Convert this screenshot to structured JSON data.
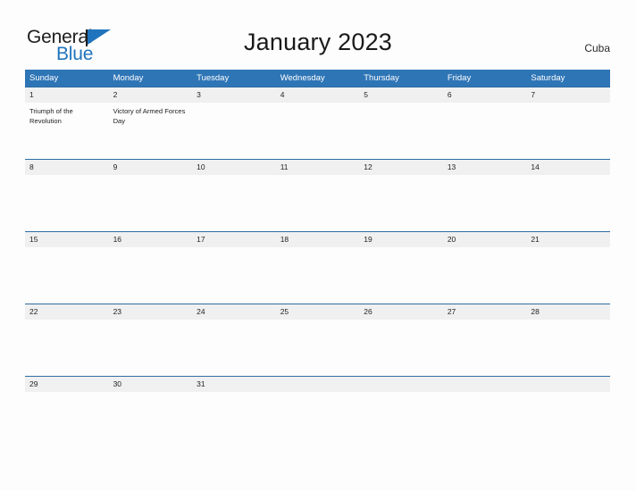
{
  "brand": {
    "name_part1": "General",
    "name_part2": "Blue",
    "flag_icon": "blue-flag-triangle",
    "color_dark": "#1d1d1d",
    "color_blue": "#1f74bd"
  },
  "header": {
    "title": "January 2023",
    "country": "Cuba"
  },
  "theme": {
    "header_blue": "#2e75b6",
    "rule_blue": "#2e6da4",
    "date_strip_gray": "#f0f0f0",
    "page_background": "#fdfdfd"
  },
  "calendar": {
    "month": "January",
    "year": "2023",
    "weekday_headers": [
      "Sunday",
      "Monday",
      "Tuesday",
      "Wednesday",
      "Thursday",
      "Friday",
      "Saturday"
    ],
    "weeks": [
      {
        "dates": [
          "1",
          "2",
          "3",
          "4",
          "5",
          "6",
          "7"
        ],
        "events": [
          [
            "Triumph of the Revolution"
          ],
          [
            "Victory of Armed Forces Day"
          ],
          [],
          [],
          [],
          [],
          []
        ]
      },
      {
        "dates": [
          "8",
          "9",
          "10",
          "11",
          "12",
          "13",
          "14"
        ],
        "events": [
          [],
          [],
          [],
          [],
          [],
          [],
          []
        ]
      },
      {
        "dates": [
          "15",
          "16",
          "17",
          "18",
          "19",
          "20",
          "21"
        ],
        "events": [
          [],
          [],
          [],
          [],
          [],
          [],
          []
        ]
      },
      {
        "dates": [
          "22",
          "23",
          "24",
          "25",
          "26",
          "27",
          "28"
        ],
        "events": [
          [],
          [],
          [],
          [],
          [],
          [],
          []
        ]
      },
      {
        "dates": [
          "29",
          "30",
          "31",
          "",
          "",
          "",
          ""
        ],
        "events": [
          [],
          [],
          [],
          [],
          [],
          [],
          []
        ]
      }
    ]
  }
}
